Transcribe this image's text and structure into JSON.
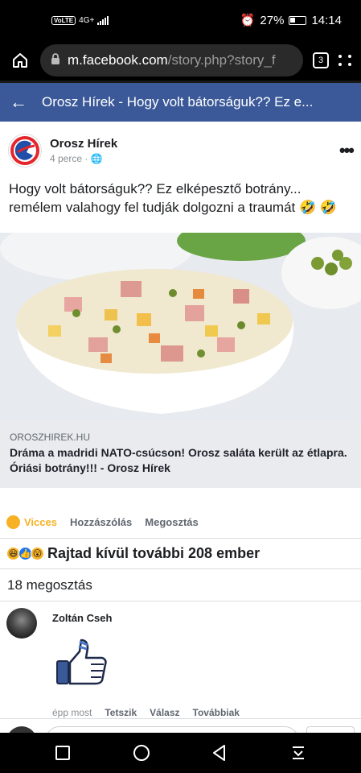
{
  "status": {
    "network": "VoLTE",
    "signal_label": "4G+",
    "battery": "27%",
    "time": "14:14"
  },
  "browser": {
    "url_domain": "m.facebook.com",
    "url_path": "/story.php?story_f",
    "tab_count": "3"
  },
  "header": {
    "title": "Orosz Hírek - Hogy volt bátorságuk?? Ez e..."
  },
  "post": {
    "page_name": "Orosz Hírek",
    "time": "4 perce",
    "text": "Hogy volt bátorságuk?? Ez elképesztő botrány... remélem valahogy fel tudják dolgozni a traumát 🤣 🤣",
    "link_domain": "OROSZHIREK.HU",
    "link_title": "Dráma a madridi NATO-csúcson! Orosz saláta került az étlapra. Óriási botrány!!! - Orosz Hírek"
  },
  "actions": {
    "reaction": "Vicces",
    "comment": "Hozzászólás",
    "share": "Megosztás"
  },
  "reactions_summary": "Rajtad kívül további 208 ember",
  "shares_count": "18 megosztás",
  "comment": {
    "author": "Zoltán Cseh",
    "time": "épp most",
    "like": "Tetszik",
    "reply": "Válasz",
    "more": "Továbbiak"
  },
  "colors": {
    "facebook_blue": "#3b5998",
    "haha_yellow": "#f7b125"
  },
  "icons": [
    "home-icon",
    "lock-icon",
    "tabs-icon",
    "more-icon",
    "back-icon",
    "globe-icon",
    "thumbs-up-sticker-icon",
    "square-nav-icon",
    "circle-nav-icon",
    "triangle-back-icon",
    "download-nav-icon"
  ]
}
